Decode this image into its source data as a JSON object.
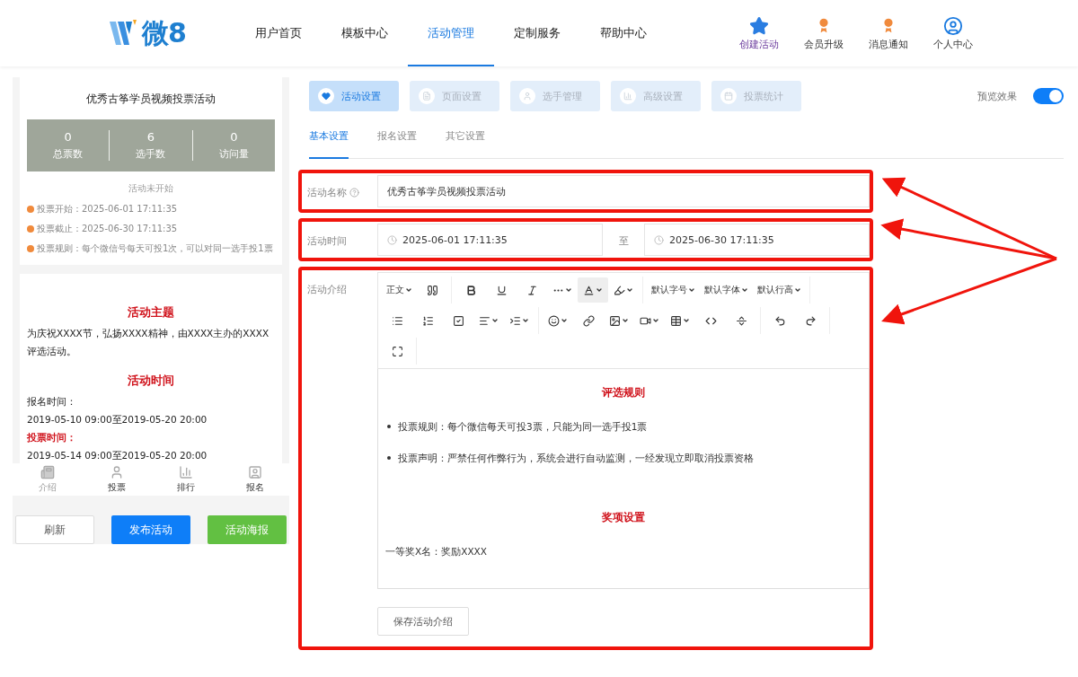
{
  "header": {
    "logo": "微8",
    "nav": [
      {
        "label": "用户首页",
        "selected": false
      },
      {
        "label": "模板中心",
        "selected": false
      },
      {
        "label": "活动管理",
        "selected": true
      },
      {
        "label": "定制服务",
        "selected": false
      },
      {
        "label": "帮助中心",
        "selected": false
      }
    ],
    "actions": [
      {
        "label": "创建活动",
        "kind": "stars"
      },
      {
        "label": "会员升级",
        "kind": "badge"
      },
      {
        "label": "消息通知",
        "kind": "badge"
      },
      {
        "label": "个人中心",
        "kind": "user"
      }
    ]
  },
  "preview": {
    "title": "优秀古筝学员视频投票活动",
    "stats": [
      {
        "value": "0",
        "label": "总票数"
      },
      {
        "value": "6",
        "label": "选手数"
      },
      {
        "value": "0",
        "label": "访问量"
      }
    ],
    "status": "活动未开始",
    "info": [
      {
        "label": "投票开始：",
        "value": "2025-06-01 17:11:35"
      },
      {
        "label": "投票截止：",
        "value": "2025-06-30 17:11:35"
      },
      {
        "label": "投票规则：",
        "value": "每个微信号每天可投1次，可以对同一选手投1票"
      }
    ],
    "content": [
      {
        "kind": "heading",
        "text": "活动主题"
      },
      {
        "kind": "text",
        "text": "为庆祝XXXX节，弘扬XXXX精神，由XXXX主办的XXXX评选活动。"
      },
      {
        "kind": "heading",
        "text": "活动时间"
      },
      {
        "kind": "text",
        "text": "报名时间："
      },
      {
        "kind": "text",
        "text": "2019-05-10 09:00至2019-05-20 20:00"
      },
      {
        "kind": "label",
        "text": "投票时间："
      },
      {
        "kind": "text",
        "text": "2019-05-14 09:00至2019-05-20 20:00"
      }
    ],
    "tabbar": [
      {
        "label": "介绍",
        "selected": true
      },
      {
        "label": "投票",
        "selected": false
      },
      {
        "label": "排行",
        "selected": false
      },
      {
        "label": "报名",
        "selected": false
      }
    ],
    "buttons": [
      {
        "label": "刷新",
        "kind": "plain"
      },
      {
        "label": "发布活动",
        "kind": "primary"
      },
      {
        "label": "活动海报",
        "kind": "success"
      }
    ]
  },
  "main": {
    "steps": [
      {
        "label": "活动设置",
        "selected": true
      },
      {
        "label": "页面设置",
        "selected": false
      },
      {
        "label": "选手管理",
        "selected": false
      },
      {
        "label": "高级设置",
        "selected": false
      },
      {
        "label": "投票统计",
        "selected": false
      }
    ],
    "preview_toggle": {
      "label": "预览效果",
      "on": true
    },
    "subtabs": [
      {
        "label": "基本设置",
        "selected": true
      },
      {
        "label": "报名设置",
        "selected": false
      },
      {
        "label": "其它设置",
        "selected": false
      }
    ],
    "name_row": {
      "label": "活动名称",
      "value": "优秀古筝学员视频投票活动",
      "highlighted": true
    },
    "time_row": {
      "label": "活动时间",
      "start": "2025-06-01 17:11:35",
      "separator": "至",
      "end": "2025-06-30 17:11:35",
      "highlighted": true
    },
    "intro_row": {
      "label": "活动介绍",
      "highlighted": true,
      "toolbar_rows": [
        [
          [
            {
              "kind": "text",
              "label": "正文",
              "caret": true
            },
            {
              "kind": "quote",
              "caret": false
            }
          ],
          [
            {
              "kind": "bold",
              "caret": false
            },
            {
              "kind": "underline",
              "caret": false
            },
            {
              "kind": "italic",
              "caret": false
            },
            {
              "kind": "more",
              "caret": true
            },
            {
              "kind": "color",
              "caret": true,
              "active": true
            },
            {
              "kind": "highlight",
              "caret": true
            }
          ],
          [
            {
              "kind": "text",
              "label": "默认字号",
              "caret": true
            },
            {
              "kind": "text",
              "label": "默认字体",
              "caret": true
            },
            {
              "kind": "text",
              "label": "默认行高",
              "caret": true
            }
          ]
        ],
        [
          [
            {
              "kind": "list",
              "caret": false
            },
            {
              "kind": "olist",
              "caret": false
            },
            {
              "kind": "todo",
              "caret": false
            },
            {
              "kind": "align",
              "caret": true
            },
            {
              "kind": "indent",
              "caret": true
            }
          ],
          [
            {
              "kind": "emoji",
              "caret": true
            },
            {
              "kind": "link",
              "caret": false
            },
            {
              "kind": "image",
              "caret": true
            },
            {
              "kind": "video",
              "caret": true
            },
            {
              "kind": "table",
              "caret": true
            },
            {
              "kind": "code",
              "caret": false
            },
            {
              "kind": "divider",
              "caret": false
            }
          ],
          [
            {
              "kind": "undo",
              "caret": false
            },
            {
              "kind": "redo",
              "caret": false
            }
          ]
        ],
        [
          [
            {
              "kind": "fullscreen",
              "caret": false
            }
          ]
        ]
      ],
      "content": [
        {
          "kind": "heading",
          "text": "评选规则"
        },
        {
          "kind": "bullet",
          "text": "投票规则：每个微信每天可投3票，只能为同一选手投1票"
        },
        {
          "kind": "bullet",
          "text": "投票声明：严禁任何作弊行为，系统会进行自动监测，一经发现立即取消投票资格"
        },
        {
          "kind": "heading",
          "text": "奖项设置"
        },
        {
          "kind": "text",
          "text": "一等奖X名：奖励XXXX"
        }
      ],
      "save_button": "保存活动介绍"
    }
  }
}
